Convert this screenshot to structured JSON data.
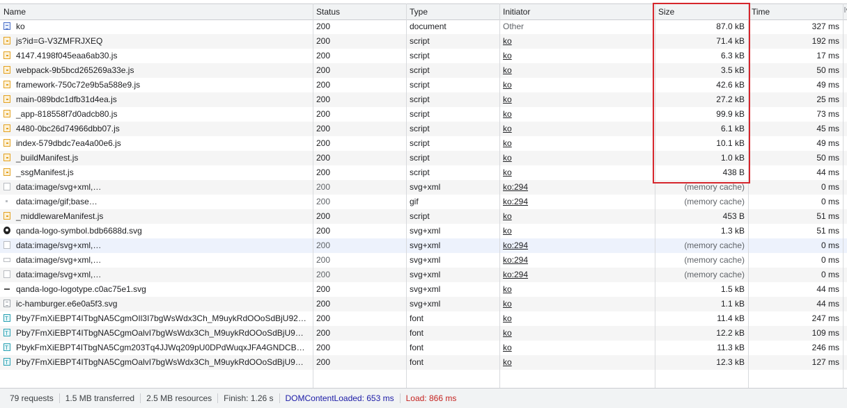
{
  "columns": {
    "name": "Name",
    "status": "Status",
    "type": "Type",
    "initiator": "Initiator",
    "size": "Size",
    "time": "Time",
    "waterfall": "W"
  },
  "rows": [
    {
      "icon": "document-icon",
      "name": "ko",
      "status": "200",
      "type": "document",
      "initiator": "Other",
      "initiator_link": false,
      "size": "87.0 kB",
      "time": "327 ms"
    },
    {
      "icon": "script-icon",
      "name": "js?id=G-V3ZMFRJXEQ",
      "status": "200",
      "type": "script",
      "initiator": "ko",
      "initiator_link": true,
      "size": "71.4 kB",
      "time": "192 ms"
    },
    {
      "icon": "script-icon",
      "name": "4147.4198f045eaa6ab30.js",
      "status": "200",
      "type": "script",
      "initiator": "ko",
      "initiator_link": true,
      "size": "6.3 kB",
      "time": "17 ms"
    },
    {
      "icon": "script-icon",
      "name": "webpack-9b5bcd265269a33e.js",
      "status": "200",
      "type": "script",
      "initiator": "ko",
      "initiator_link": true,
      "size": "3.5 kB",
      "time": "50 ms"
    },
    {
      "icon": "script-icon",
      "name": "framework-750c72e9b5a588e9.js",
      "status": "200",
      "type": "script",
      "initiator": "ko",
      "initiator_link": true,
      "size": "42.6 kB",
      "time": "49 ms"
    },
    {
      "icon": "script-icon",
      "name": "main-089bdc1dfb31d4ea.js",
      "status": "200",
      "type": "script",
      "initiator": "ko",
      "initiator_link": true,
      "size": "27.2 kB",
      "time": "25 ms"
    },
    {
      "icon": "script-icon",
      "name": "_app-818558f7d0adcb80.js",
      "status": "200",
      "type": "script",
      "initiator": "ko",
      "initiator_link": true,
      "size": "99.9 kB",
      "time": "73 ms"
    },
    {
      "icon": "script-icon",
      "name": "4480-0bc26d74966dbb07.js",
      "status": "200",
      "type": "script",
      "initiator": "ko",
      "initiator_link": true,
      "size": "6.1 kB",
      "time": "45 ms"
    },
    {
      "icon": "script-icon",
      "name": "index-579dbdc7ea4a00e6.js",
      "status": "200",
      "type": "script",
      "initiator": "ko",
      "initiator_link": true,
      "size": "10.1 kB",
      "time": "49 ms"
    },
    {
      "icon": "script-icon",
      "name": "_buildManifest.js",
      "status": "200",
      "type": "script",
      "initiator": "ko",
      "initiator_link": true,
      "size": "1.0 kB",
      "time": "50 ms"
    },
    {
      "icon": "script-icon",
      "name": "_ssgManifest.js",
      "status": "200",
      "type": "script",
      "initiator": "ko",
      "initiator_link": true,
      "size": "438 B",
      "time": "44 ms"
    },
    {
      "icon": "image-icon",
      "name": "data:image/svg+xml,…",
      "status": "200",
      "type": "svg+xml",
      "initiator": "ko:294",
      "initiator_link": true,
      "size": "(memory cache)",
      "time": "0 ms",
      "muted": true
    },
    {
      "icon": "dot-icon",
      "name": "data:image/gif;base…",
      "status": "200",
      "type": "gif",
      "initiator": "ko:294",
      "initiator_link": true,
      "size": "(memory cache)",
      "time": "0 ms",
      "muted": true
    },
    {
      "icon": "script-icon",
      "name": "_middlewareManifest.js",
      "status": "200",
      "type": "script",
      "initiator": "ko",
      "initiator_link": true,
      "size": "453 B",
      "time": "51 ms"
    },
    {
      "icon": "logo-symbol-icon",
      "name": "qanda-logo-symbol.bdb6688d.svg",
      "status": "200",
      "type": "svg+xml",
      "initiator": "ko",
      "initiator_link": true,
      "size": "1.3 kB",
      "time": "51 ms"
    },
    {
      "icon": "image-icon",
      "name": "data:image/svg+xml,…",
      "status": "200",
      "type": "svg+xml",
      "initiator": "ko:294",
      "initiator_link": true,
      "size": "(memory cache)",
      "time": "0 ms",
      "muted": true,
      "selected": true
    },
    {
      "icon": "rect-icon",
      "name": "data:image/svg+xml,…",
      "status": "200",
      "type": "svg+xml",
      "initiator": "ko:294",
      "initiator_link": true,
      "size": "(memory cache)",
      "time": "0 ms",
      "muted": true
    },
    {
      "icon": "image-icon",
      "name": "data:image/svg+xml,…",
      "status": "200",
      "type": "svg+xml",
      "initiator": "ko:294",
      "initiator_link": true,
      "size": "(memory cache)",
      "time": "0 ms",
      "muted": true
    },
    {
      "icon": "logotype-icon",
      "name": "qanda-logo-logotype.c0ac75e1.svg",
      "status": "200",
      "type": "svg+xml",
      "initiator": "ko",
      "initiator_link": true,
      "size": "1.5 kB",
      "time": "44 ms"
    },
    {
      "icon": "hamburger-icon",
      "name": "ic-hamburger.e6e0a5f3.svg",
      "status": "200",
      "type": "svg+xml",
      "initiator": "ko",
      "initiator_link": true,
      "size": "1.1 kB",
      "time": "44 ms"
    },
    {
      "icon": "font-icon",
      "name": "Pby7FmXiEBPT4ITbgNA5CgmOIl3I7bgWsWdx3Ch_M9uykRdOOoSdBjU92…",
      "status": "200",
      "type": "font",
      "initiator": "ko",
      "initiator_link": true,
      "size": "11.4 kB",
      "time": "247 ms"
    },
    {
      "icon": "font-icon",
      "name": "Pby7FmXiEBPT4ITbgNA5CgmOalvI7bgWsWdx3Ch_M9uykRdOOoSdBjU9…",
      "status": "200",
      "type": "font",
      "initiator": "ko",
      "initiator_link": true,
      "size": "12.2 kB",
      "time": "109 ms"
    },
    {
      "icon": "font-icon",
      "name": "PbykFmXiEBPT4ITbgNA5Cgm203Tq4JJWq209pU0DPdWuqxJFA4GNDCB…",
      "status": "200",
      "type": "font",
      "initiator": "ko",
      "initiator_link": true,
      "size": "11.3 kB",
      "time": "246 ms"
    },
    {
      "icon": "font-icon",
      "name": "Pby7FmXiEBPT4ITbgNA5CgmOalvI7bgWsWdx3Ch_M9uykRdOOoSdBjU9…",
      "status": "200",
      "type": "font",
      "initiator": "ko",
      "initiator_link": true,
      "size": "12.3 kB",
      "time": "127 ms"
    }
  ],
  "footer": {
    "requests": "79 requests",
    "transferred": "1.5 MB transferred",
    "resources": "2.5 MB resources",
    "finish": "Finish: 1.26 s",
    "dom_content_loaded": "DOMContentLoaded: 653 ms",
    "load": "Load: 866 ms"
  },
  "colors": {
    "highlight": "#d6262c",
    "dom_content_loaded": "#1a1aa6",
    "load": "#c5221f",
    "header_bg": "#f1f3f4"
  }
}
